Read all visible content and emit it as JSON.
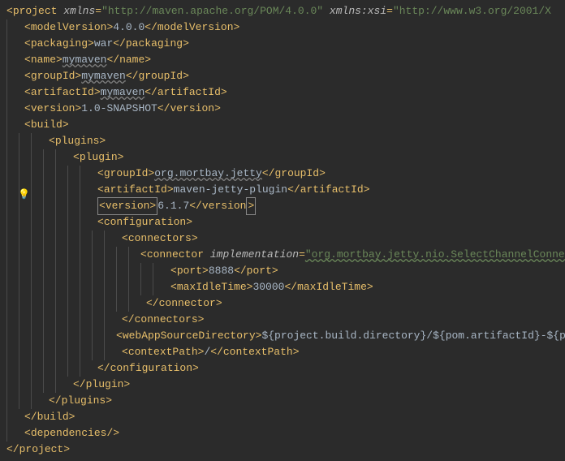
{
  "root": {
    "tag": "project",
    "xmlns_attr": "xmlns",
    "xmlns_val": "\"http://maven.apache.org/POM/4.0.0\"",
    "xsi_attr": "xmlns:xsi",
    "xsi_val": "\"http://www.w3.org/2001/X"
  },
  "modelVersion": {
    "tag": "modelVersion",
    "val": "4.0.0"
  },
  "packaging": {
    "tag": "packaging",
    "val": "war"
  },
  "name": {
    "tag": "name",
    "val": "mymaven"
  },
  "groupId": {
    "tag": "groupId",
    "val": "mymaven"
  },
  "artifactId": {
    "tag": "artifactId",
    "val": "mymaven"
  },
  "version": {
    "tag": "version",
    "val": "1.0-SNAPSHOT"
  },
  "build": {
    "tag": "build"
  },
  "plugins": {
    "tag": "plugins"
  },
  "plugin": {
    "tag": "plugin"
  },
  "p_groupId": {
    "tag": "groupId",
    "val": "org.mortbay.jetty"
  },
  "p_artifactId": {
    "tag": "artifactId",
    "val": "maven-jetty-plugin"
  },
  "p_version": {
    "tag": "version",
    "val": "6.1.7"
  },
  "configuration": {
    "tag": "configuration"
  },
  "connectors": {
    "tag": "connectors"
  },
  "connector": {
    "tag": "connector",
    "impl_attr": "implementation",
    "impl_val": "\"org.mortbay.jetty.nio.SelectChannelConnector\""
  },
  "port": {
    "tag": "port",
    "val": "8888"
  },
  "maxIdleTime": {
    "tag": "maxIdleTime",
    "val": "30000"
  },
  "webAppSourceDirectory": {
    "tag": "webAppSourceDirectory",
    "val": "${project.build.directory}/${pom.artifactId}-${pom.ve"
  },
  "contextPath": {
    "tag": "contextPath",
    "val": "/"
  },
  "dependencies": {
    "tag": "dependencies"
  }
}
